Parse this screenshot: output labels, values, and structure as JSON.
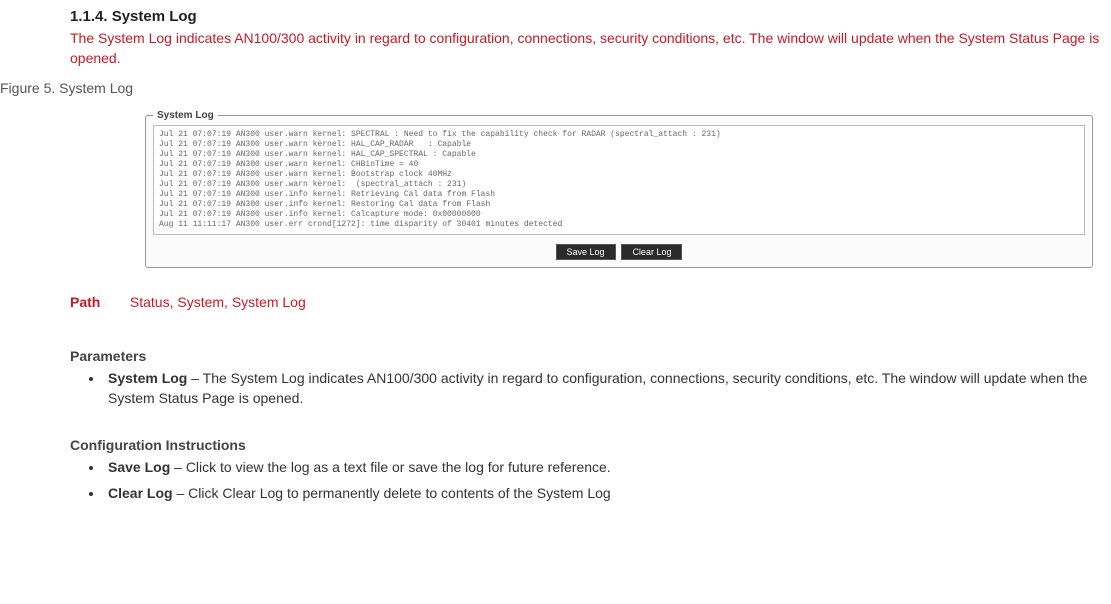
{
  "heading": "1.1.4. System Log",
  "intro": "The System Log indicates AN100/300 activity in regard to configuration, connections, security conditions, etc. The window will update when the System Status Page is opened.",
  "figure_caption": "Figure 5. System Log",
  "syslog": {
    "legend": "System Log",
    "lines": "Jul 21 07:07:19 AN300 user.warn kernel: SPECTRAL : Need to fix the capability check for RADAR (spectral_attach : 231)\nJul 21 07:07:19 AN300 user.warn kernel: HAL_CAP_RADAR   : Capable\nJul 21 07:07:19 AN300 user.warn kernel: HAL_CAP_SPECTRAL : Capable\nJul 21 07:07:19 AN300 user.warn kernel: CHBinTime = 40\nJul 21 07:07:19 AN300 user.warn kernel: Bootstrap clock 40MHz\nJul 21 07:07:19 AN300 user.warn kernel:  (spectral_attach : 231)\nJul 21 07:07:19 AN300 user.info kernel: Retrieving Cal data from Flash\nJul 21 07:07:19 AN300 user.info kernel: Restoring Cal data from Flash\nJul 21 07:07:19 AN300 user.info kernel: Calcapture mode: 0x00000000\nAug 11 11:11:17 AN300 user.err crond[1272]: time disparity of 30401 minutes detected\n",
    "save_btn": "Save Log",
    "clear_btn": "Clear Log"
  },
  "path": {
    "label": "Path",
    "value": "Status, System, System Log"
  },
  "parameters_heading": "Parameters",
  "parameters": [
    {
      "name": "System Log",
      "desc": " – The System Log indicates AN100/300 activity in regard to configuration, connections, security conditions, etc. The window will update when the System Status Page is opened."
    }
  ],
  "config_heading": "Configuration Instructions",
  "config_items": [
    {
      "name": "Save Log",
      "desc": " – Click to view the log as a text file or save the log for future reference."
    },
    {
      "name": "Clear Log",
      "desc": " – Click Clear Log to permanently delete to contents of the System Log"
    }
  ]
}
